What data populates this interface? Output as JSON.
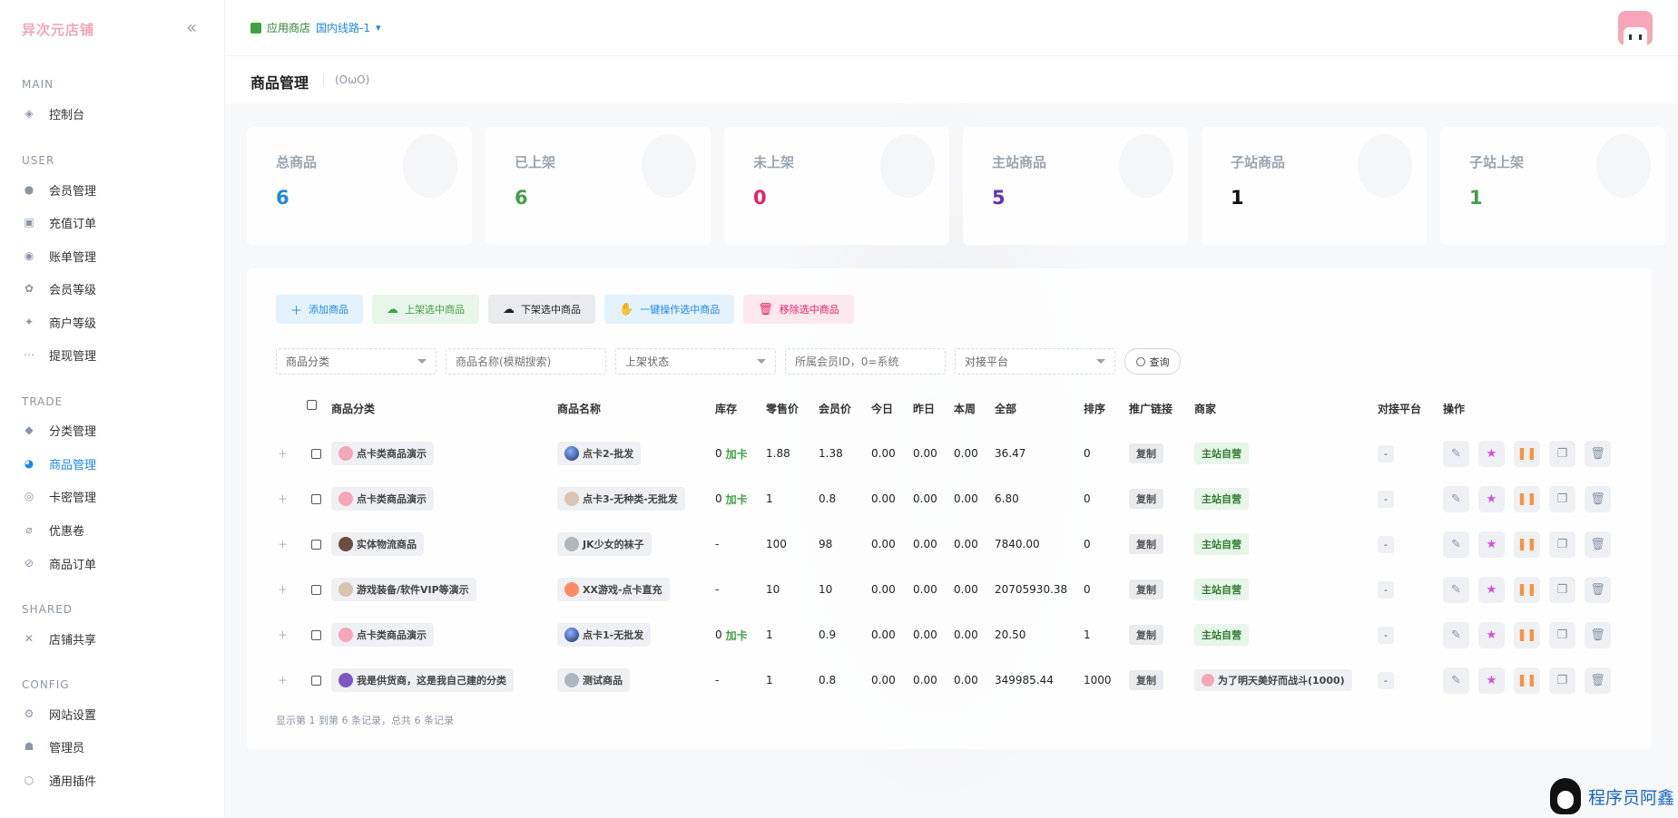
{
  "brand": "异次元店铺",
  "sidebar": {
    "sections": [
      {
        "title": "MAIN",
        "items": [
          {
            "label": "控制台",
            "icon": "dashboard-icon"
          }
        ]
      },
      {
        "title": "USER",
        "items": [
          {
            "label": "会员管理",
            "icon": "user-icon"
          },
          {
            "label": "充值订单",
            "icon": "recharge-icon"
          },
          {
            "label": "账单管理",
            "icon": "bill-icon"
          },
          {
            "label": "会员等级",
            "icon": "level-icon"
          },
          {
            "label": "商户等级",
            "icon": "merchant-level-icon"
          },
          {
            "label": "提现管理",
            "icon": "withdraw-icon"
          }
        ]
      },
      {
        "title": "TRADE",
        "items": [
          {
            "label": "分类管理",
            "icon": "category-icon"
          },
          {
            "label": "商品管理",
            "icon": "goods-icon",
            "active": true
          },
          {
            "label": "卡密管理",
            "icon": "card-icon"
          },
          {
            "label": "优惠卷",
            "icon": "coupon-icon"
          },
          {
            "label": "商品订单",
            "icon": "order-icon"
          }
        ]
      },
      {
        "title": "SHARED",
        "items": [
          {
            "label": "店铺共享",
            "icon": "share-icon"
          }
        ]
      },
      {
        "title": "CONFIG",
        "items": [
          {
            "label": "网站设置",
            "icon": "settings-icon"
          },
          {
            "label": "管理员",
            "icon": "admin-icon"
          },
          {
            "label": "通用插件",
            "icon": "plugin-icon"
          }
        ]
      }
    ]
  },
  "topbar": {
    "store_label": "应用商店",
    "line_label": "国内线路-1"
  },
  "page": {
    "title": "商品管理",
    "subtitle": "(OωO)"
  },
  "stats": [
    {
      "label": "总商品",
      "value": "6",
      "color": "#1e88e5"
    },
    {
      "label": "已上架",
      "value": "6",
      "color": "#43a047"
    },
    {
      "label": "未上架",
      "value": "0",
      "color": "#e91e63"
    },
    {
      "label": "主站商品",
      "value": "5",
      "color": "#5e35b1"
    },
    {
      "label": "子站商品",
      "value": "1",
      "color": "#111111"
    },
    {
      "label": "子站上架",
      "value": "1",
      "color": "#43a047"
    }
  ],
  "actions": {
    "add": "添加商品",
    "up": "上架选中商品",
    "down": "下架选中商品",
    "batch": "一键操作选中商品",
    "remove": "移除选中商品"
  },
  "filters": {
    "category": "商品分类",
    "name_placeholder": "商品名称(模糊搜索)",
    "status": "上架状态",
    "member_placeholder": "所属会员ID，0=系统",
    "platform": "对接平台",
    "search": "查询"
  },
  "table": {
    "headers": [
      "商品分类",
      "商品名称",
      "库存",
      "零售价",
      "会员价",
      "今日",
      "昨日",
      "本周",
      "全部",
      "排序",
      "推广链接",
      "商家",
      "对接平台",
      "操作"
    ],
    "rows": [
      {
        "category": "点卡类商品演示",
        "cat_ava": "pink",
        "name": "点卡2-批发",
        "name_ava": "planet",
        "stock": "0",
        "addcard": "加卡",
        "retail": "1.88",
        "member": "1.38",
        "today": "0.00",
        "yesterday": "0.00",
        "week": "0.00",
        "total": "36.47",
        "sort": "0",
        "link": "复制",
        "merchant": "主站自营",
        "merchant_type": "self",
        "platform": "-"
      },
      {
        "category": "点卡类商品演示",
        "cat_ava": "pink",
        "name": "点卡3-无种类-无批发",
        "name_ava": "face",
        "stock": "0",
        "addcard": "加卡",
        "retail": "1",
        "member": "0.8",
        "today": "0.00",
        "yesterday": "0.00",
        "week": "0.00",
        "total": "6.80",
        "sort": "0",
        "link": "复制",
        "merchant": "主站自营",
        "merchant_type": "self",
        "platform": "-"
      },
      {
        "category": "实体物流商品",
        "cat_ava": "dark",
        "name": "JK少女的袜子",
        "name_ava": "gray",
        "stock": "-",
        "addcard": "",
        "retail": "100",
        "member": "98",
        "today": "0.00",
        "yesterday": "0.00",
        "week": "0.00",
        "total": "7840.00",
        "sort": "0",
        "link": "复制",
        "merchant": "主站自营",
        "merchant_type": "self",
        "platform": "-"
      },
      {
        "category": "游戏装备/软件VIP等演示",
        "cat_ava": "face",
        "name": "XX游戏-点卡直充",
        "name_ava": "orange",
        "stock": "-",
        "addcard": "",
        "retail": "10",
        "member": "10",
        "today": "0.00",
        "yesterday": "0.00",
        "week": "0.00",
        "total": "20705930.38",
        "sort": "0",
        "link": "复制",
        "merchant": "主站自营",
        "merchant_type": "self",
        "platform": "-"
      },
      {
        "category": "点卡类商品演示",
        "cat_ava": "pink",
        "name": "点卡1-无批发",
        "name_ava": "planet",
        "stock": "0",
        "addcard": "加卡",
        "retail": "1",
        "member": "0.9",
        "today": "0.00",
        "yesterday": "0.00",
        "week": "0.00",
        "total": "20.50",
        "sort": "1",
        "link": "复制",
        "merchant": "主站自营",
        "merchant_type": "self",
        "platform": "-"
      },
      {
        "category": "我是供货商，这是我自己建的分类",
        "cat_ava": "purple",
        "name": "测试商品",
        "name_ava": "gray",
        "stock": "-",
        "addcard": "",
        "retail": "1",
        "member": "0.8",
        "today": "0.00",
        "yesterday": "0.00",
        "week": "0.00",
        "total": "349985.44",
        "sort": "1000",
        "link": "复制",
        "merchant": "为了明天美好而战斗(1000)",
        "merchant_type": "user",
        "platform": "-"
      }
    ],
    "footer": "显示第 1 到第 6 条记录，总共 6 条记录"
  },
  "watermark": "程序员阿鑫"
}
